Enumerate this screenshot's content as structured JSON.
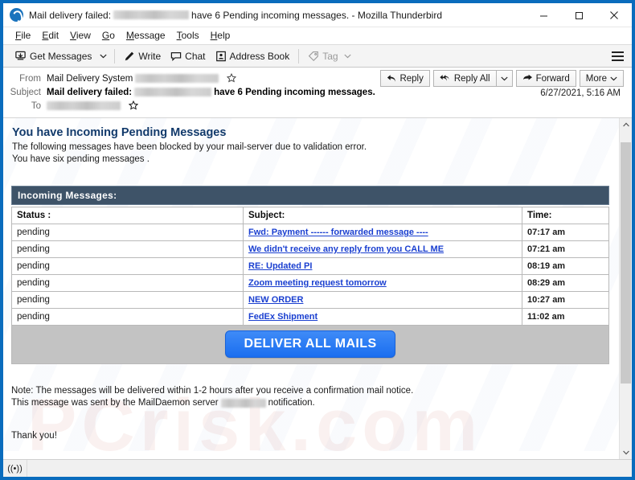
{
  "window": {
    "title_prefix": "Mail delivery failed:",
    "title_suffix": "have 6 Pending incoming messages. - Mozilla Thunderbird",
    "app_name": "Mozilla Thunderbird",
    "border_color": "#0a6cbd",
    "controls": {
      "minimize": "minimize-icon",
      "maximize": "maximize-icon",
      "close": "close-icon"
    }
  },
  "menubar": {
    "items": [
      {
        "label": "File",
        "accesskey": "F"
      },
      {
        "label": "Edit",
        "accesskey": "E"
      },
      {
        "label": "View",
        "accesskey": "V"
      },
      {
        "label": "Go",
        "accesskey": "G"
      },
      {
        "label": "Message",
        "accesskey": "M"
      },
      {
        "label": "Tools",
        "accesskey": "T"
      },
      {
        "label": "Help",
        "accesskey": "H"
      }
    ]
  },
  "toolbar": {
    "get_messages": "Get Messages",
    "write": "Write",
    "chat": "Chat",
    "address_book": "Address Book",
    "tag": "Tag",
    "dropdown_glyph": "⌄",
    "menu_icon": "hamburger-icon"
  },
  "message_header": {
    "from_label": "From",
    "from_name": "Mail Delivery System",
    "from_address_redacted": true,
    "subject_label": "Subject",
    "subject_prefix": "Mail delivery failed:",
    "subject_suffix": "have 6 Pending incoming messages.",
    "to_label": "To",
    "to_address_redacted": true,
    "date": "6/27/2021, 5:16 AM",
    "star_glyph": "☆",
    "actions": [
      {
        "label": "Reply",
        "icon": "reply-arrow-icon"
      },
      {
        "label": "Reply All",
        "icon": "reply-all-arrow-icon"
      },
      {
        "label": "Forward",
        "icon": "forward-arrow-icon"
      },
      {
        "label": "More",
        "icon": "chevron-down-icon"
      }
    ]
  },
  "email": {
    "heading": "You have Incoming Pending Messages",
    "intro_line1": "The following messages have been blocked by your mail-server due to validation error.",
    "intro_line2": "You have six pending messages .",
    "table_caption": "Incoming  Messages:",
    "columns": [
      "Status :",
      "Subject:",
      "Time:"
    ],
    "rows": [
      {
        "status": "pending",
        "subject": "Fwd: Payment  ------ forwarded message ----",
        "time": "07:17 am"
      },
      {
        "status": "pending",
        "subject": "We didn't receive any reply from you CALL ME",
        "time": "07:21 am"
      },
      {
        "status": "pending",
        "subject": "RE: Updated PI",
        "time": "08:19 am"
      },
      {
        "status": "pending",
        "subject": "Zoom meeting request tomorrow",
        "time": "08:29 am"
      },
      {
        "status": "pending",
        "subject": "NEW ORDER",
        "time": "10:27  am"
      },
      {
        "status": "pending",
        "subject": "FedEx Shipment",
        "time": "11:02 am"
      }
    ],
    "deliver_button": "DELIVER ALL MAILS",
    "note_line1": "Note: The messages will be delivered within 1-2 hours after you receive a confirmation mail notice.",
    "note_line2_pre": "This message was sent by the MailDaemon server",
    "note_line2_post": "notification.",
    "closing": "Thank you!",
    "colors": {
      "heading": "#123a6b",
      "table_header_bg": "#3e5368",
      "link": "#1a3fd0",
      "button_bg": "#2b7ef5",
      "band_bg": "#c3c3c3"
    }
  },
  "statusbar": {
    "icon": "online-status-icon",
    "glyph": "((•))"
  }
}
